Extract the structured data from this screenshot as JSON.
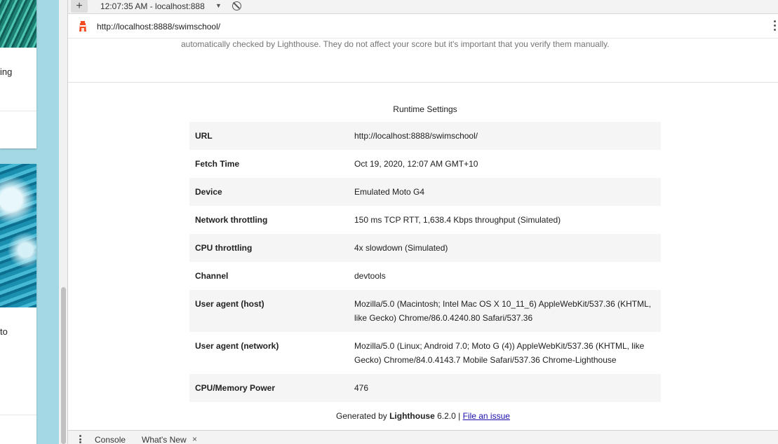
{
  "left_page": {
    "card1_text": "ing",
    "card2_text": "to"
  },
  "toolbar": {
    "new_report_label": "+",
    "report_select_value": "12:07:35 AM - localhost:888",
    "dropdown_arrow": "▼"
  },
  "urlbar": {
    "url": "http://localhost:8888/swimschool/"
  },
  "report": {
    "manual_note": "automatically checked by Lighthouse. They do not affect your score but it's important that you verify them manually.",
    "runtime_title": "Runtime Settings",
    "runtime_rows": [
      {
        "key": "URL",
        "value": "http://localhost:8888/swimschool/"
      },
      {
        "key": "Fetch Time",
        "value": "Oct 19, 2020, 12:07 AM GMT+10"
      },
      {
        "key": "Device",
        "value": "Emulated Moto G4"
      },
      {
        "key": "Network throttling",
        "value": "150 ms TCP RTT, 1,638.4 Kbps throughput (Simulated)"
      },
      {
        "key": "CPU throttling",
        "value": "4x slowdown (Simulated)"
      },
      {
        "key": "Channel",
        "value": "devtools"
      },
      {
        "key": "User agent (host)",
        "value": "Mozilla/5.0 (Macintosh; Intel Mac OS X 10_11_6) AppleWebKit/537.36 (KHTML, like Gecko) Chrome/86.0.4240.80 Safari/537.36"
      },
      {
        "key": "User agent (network)",
        "value": "Mozilla/5.0 (Linux; Android 7.0; Moto G (4)) AppleWebKit/537.36 (KHTML, like Gecko) Chrome/84.0.4143.7 Mobile Safari/537.36 Chrome-Lighthouse"
      },
      {
        "key": "CPU/Memory Power",
        "value": "476"
      }
    ],
    "footer": {
      "prefix": "Generated by ",
      "brand": "Lighthouse",
      "version": " 6.2.0 | ",
      "link": "File an issue"
    }
  },
  "drawer": {
    "tabs": [
      {
        "label": "Console"
      },
      {
        "label": "What's New"
      }
    ],
    "close_glyph": "×"
  },
  "colors": {
    "accent_link": "#1a0dab",
    "lighthouse_red": "#f44b21",
    "page_bg_left": "#a3d8e4"
  },
  "icons": [
    "plus-icon",
    "clear-icon",
    "lighthouse-icon",
    "more-vertical-icon",
    "drawer-menu-icon",
    "close-icon"
  ]
}
